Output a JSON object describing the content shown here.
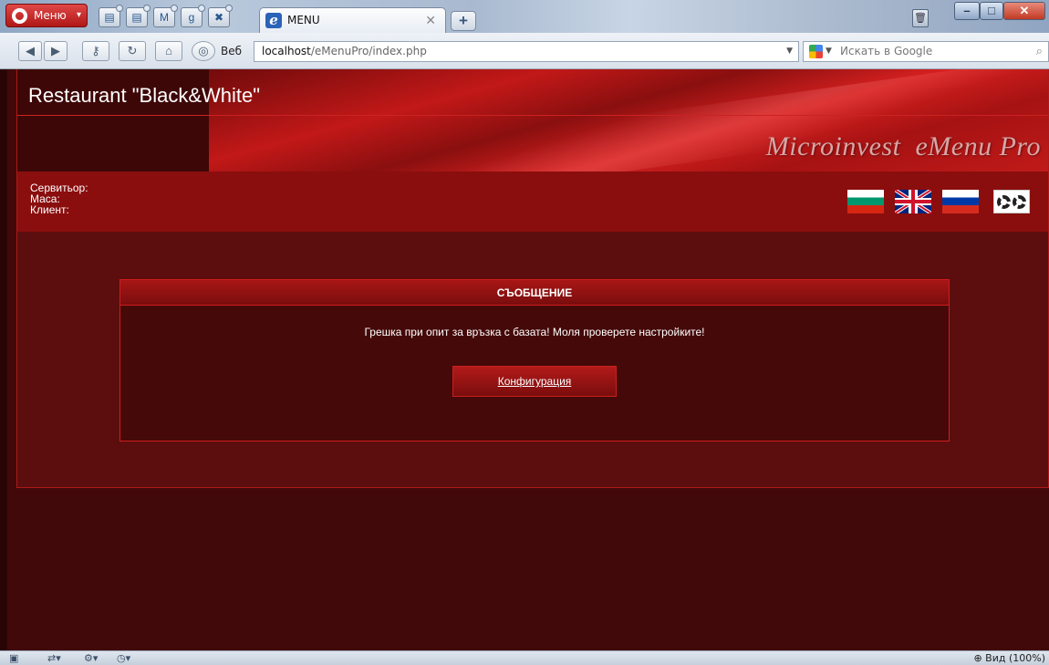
{
  "browser": {
    "menu_label": "Меню",
    "tab_title": "MENU",
    "web_label": "Веб",
    "url_host": "localhost",
    "url_path": "/eMenuPro/index.php",
    "search_placeholder": "Искать в Google",
    "zoom_label": "Вид (100%)"
  },
  "app": {
    "restaurant_name": "Restaurant \"Black&White\"",
    "product_name_part1": "Microinvest",
    "product_name_part2": "eMenu Pro",
    "info": {
      "waiter_label": "Сервитьор:",
      "table_label": "Маса:",
      "client_label": "Клиент:"
    },
    "languages": [
      "bg-flag-icon",
      "uk-flag-icon",
      "ru-flag-icon"
    ],
    "message": {
      "title": "СЪОБЩЕНИЕ",
      "text": "Грешка при опит за връзка с базата! Моля проверете настройките!",
      "button_label": "Конфигурация"
    }
  },
  "colors": {
    "page_background": "#410909",
    "frame_background": "#5c0d0d",
    "accent_red": "#d11c1c",
    "info_bar": "#8a0e0e"
  }
}
